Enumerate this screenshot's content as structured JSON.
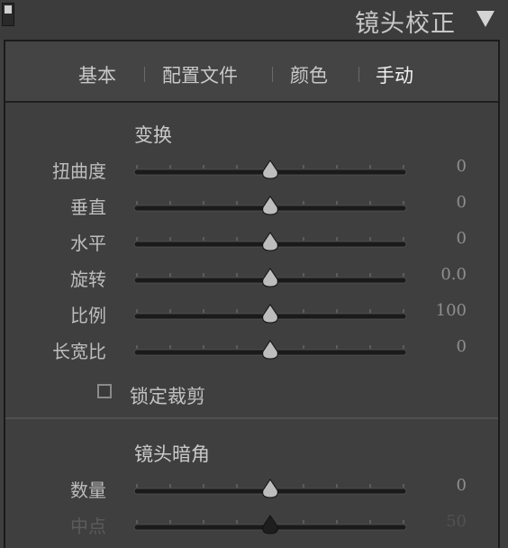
{
  "header": {
    "title": "镜头校正"
  },
  "tabs": [
    {
      "label": "基本"
    },
    {
      "label": "配置文件"
    },
    {
      "label": "颜色"
    },
    {
      "label": "手动"
    }
  ],
  "transform": {
    "title": "变换",
    "rows": [
      {
        "label": "扭曲度",
        "value": "0",
        "position": 0.5
      },
      {
        "label": "垂直",
        "value": "0",
        "position": 0.5
      },
      {
        "label": "水平",
        "value": "0",
        "position": 0.5
      },
      {
        "label": "旋转",
        "value": "0.0",
        "position": 0.5
      },
      {
        "label": "比例",
        "value": "100",
        "position": 0.5
      },
      {
        "label": "长宽比",
        "value": "0",
        "position": 0.5
      }
    ],
    "constrain_crop_label": "锁定裁剪",
    "constrain_crop_checked": false
  },
  "vignetting": {
    "title": "镜头暗角",
    "rows": [
      {
        "label": "数量",
        "value": "0",
        "position": 0.5,
        "enabled": true
      },
      {
        "label": "中点",
        "value": "50",
        "position": 0.5,
        "enabled": false
      }
    ]
  },
  "colors": {
    "thumb": "#bdbdbd",
    "thumb_disabled": "#1e1e1e",
    "track": "#1a1a1a",
    "tick": "#7a7a7a"
  }
}
